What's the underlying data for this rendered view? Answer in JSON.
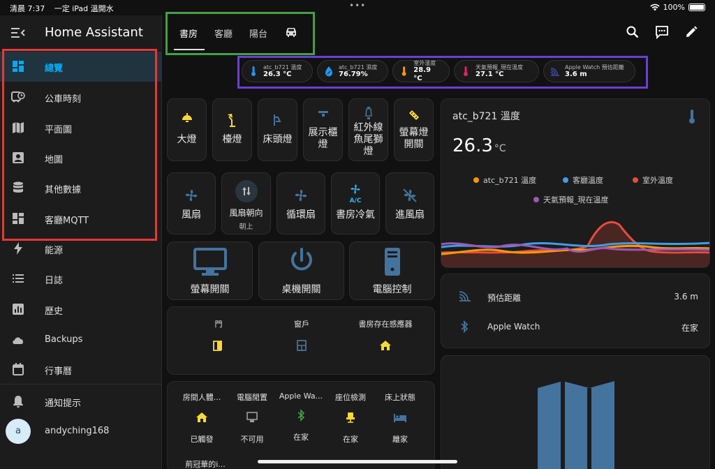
{
  "status_bar": {
    "time": "清晨 7:37",
    "app": "一定 iPad 溫開水",
    "battery": "100%"
  },
  "sidebar": {
    "title": "Home Assistant",
    "items": [
      {
        "label": "總覽",
        "icon": "dashboard-icon",
        "active": true
      },
      {
        "label": "公車時刻",
        "icon": "bus-clock-icon"
      },
      {
        "label": "平面圖",
        "icon": "map-icon"
      },
      {
        "label": "地圖",
        "icon": "account-box-icon"
      },
      {
        "label": "其他數據",
        "icon": "database-icon"
      },
      {
        "label": "客廳MQTT",
        "icon": "dashboard-icon"
      },
      {
        "label": "能源",
        "icon": "lightning-icon"
      },
      {
        "label": "日誌",
        "icon": "list-icon"
      },
      {
        "label": "歷史",
        "icon": "chart-box-icon"
      },
      {
        "label": "Backups",
        "icon": "cloud-icon"
      },
      {
        "label": "行事曆",
        "icon": "calendar-icon"
      }
    ],
    "notifications": "通知提示",
    "user": {
      "initial": "a",
      "name": "andyching168"
    }
  },
  "tabs": [
    {
      "label": "書房",
      "active": true
    },
    {
      "label": "客廳"
    },
    {
      "label": "陽台"
    }
  ],
  "badges": [
    {
      "name": "atc_b721 溫度",
      "value": "26.3 °C",
      "icon": "thermometer-icon",
      "color": "#2196f3"
    },
    {
      "name": "atc_b721 濕度",
      "value": "76.79%",
      "icon": "water-percent-icon",
      "color": "#2196f3"
    },
    {
      "name": "室外溫度",
      "value": "28.9 °C",
      "icon": "thermometer-icon",
      "color": "#ff9800"
    },
    {
      "name": "天氣預報_現在溫度",
      "value": "27.1 °C",
      "icon": "thermometer-icon",
      "color": "#e91e63"
    },
    {
      "name": "Apple Watch 預估距離",
      "value": "3.6 m",
      "icon": "signal-distance-icon",
      "color": "#3f51b5"
    }
  ],
  "lights": [
    {
      "label": "大燈",
      "icon": "ceiling-light-icon"
    },
    {
      "label": "檯燈",
      "icon": "desk-lamp-icon"
    },
    {
      "label": "床頭燈",
      "icon": "wall-lamp-icon"
    },
    {
      "label": "展示櫃\n燈",
      "icon": "track-light-icon"
    },
    {
      "label": "紅外線\n魚尾獅\n燈",
      "icon": "lightbulb-icon"
    },
    {
      "label": "螢幕燈\n開關",
      "icon": "light-bar-icon"
    }
  ],
  "fans": [
    {
      "label": "風扇",
      "icon": "fan-icon"
    },
    {
      "label": "風扇朝向",
      "state": "朝上",
      "icon": "swap-vertical-icon"
    },
    {
      "label": "循環扇",
      "icon": "fan-icon"
    },
    {
      "label": "書房冷氣",
      "icon": "air-conditioner-icon"
    },
    {
      "label": "進風扇",
      "icon": "fan-off-icon"
    }
  ],
  "computer": [
    {
      "label": "螢幕開關",
      "icon": "monitor-icon"
    },
    {
      "label": "桌機開關",
      "icon": "power-icon"
    },
    {
      "label": "電腦控制",
      "icon": "desktop-tower-icon"
    }
  ],
  "doors": [
    {
      "label": "門",
      "icon": "door-open-icon"
    },
    {
      "label": "窗戶",
      "icon": "window-closed-icon"
    },
    {
      "label": "書房存在感應器",
      "icon": "home-icon"
    }
  ],
  "presence": [
    {
      "label": "房間人體...",
      "state": "已觸發",
      "icon": "home-icon"
    },
    {
      "label": "電腦閒置",
      "state": "不可用",
      "icon": "monitor-icon"
    },
    {
      "label": "Apple Wa...",
      "state": "在家",
      "icon": "bluetooth-icon"
    },
    {
      "label": "座位檢測",
      "state": "在家",
      "icon": "seat-icon"
    },
    {
      "label": "床上狀態",
      "state": "離家",
      "icon": "bed-icon"
    }
  ],
  "presence_extra": "荊冠華的i...",
  "sensor_card": {
    "title": "atc_b721 溫度",
    "value": "26.3",
    "unit": "°C",
    "legend": [
      {
        "name": "atc_b721 溫度",
        "color": "#ff9800"
      },
      {
        "name": "客廳溫度",
        "color": "#3f9ee8"
      },
      {
        "name": "室外溫度",
        "color": "#e74c3c"
      },
      {
        "name": "天氣預報_現在溫度",
        "color": "#9b59b6"
      }
    ]
  },
  "watch_card": {
    "rows": [
      {
        "label": "預估距離",
        "value": "3.6 m",
        "icon": "signal-distance-icon"
      },
      {
        "label": "Apple Watch",
        "value": "在家",
        "icon": "bluetooth-icon"
      }
    ]
  },
  "colors": {
    "accent": "#03a9f4",
    "light_on": "#fdd835",
    "icon_blue": "#44739e",
    "annotation_red": "#e53935",
    "annotation_green": "#43a047",
    "annotation_purple": "#6b3fd4"
  }
}
